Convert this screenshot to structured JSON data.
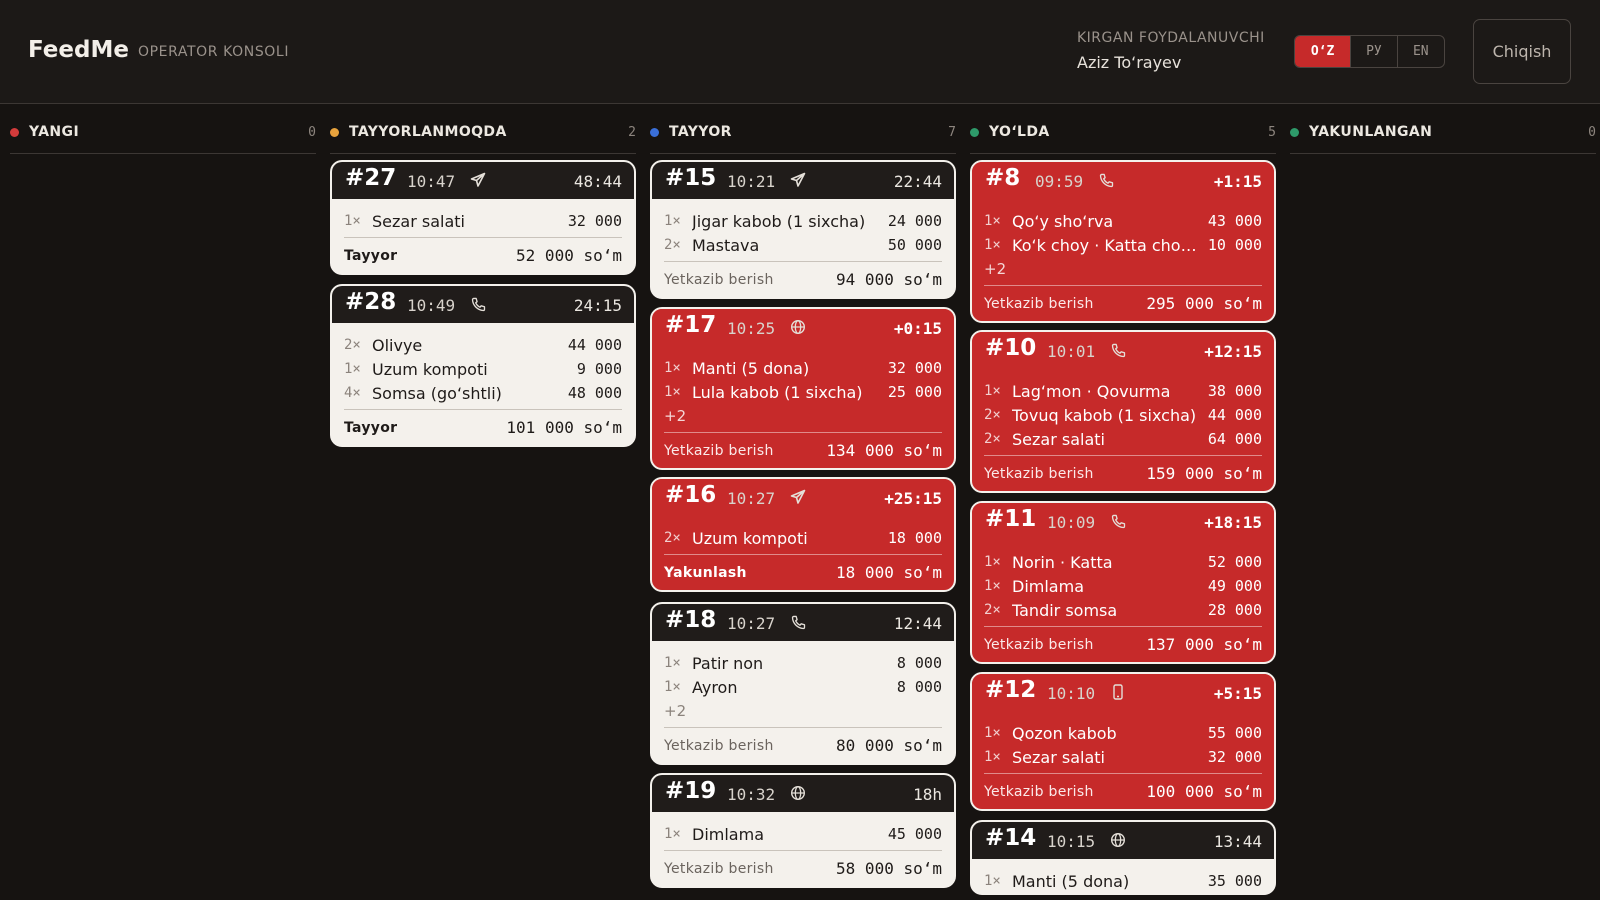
{
  "header": {
    "brand": "FeedMe",
    "subtitle": "OPERATOR KONSOLI",
    "user_label": "KIRGAN FOYDALANUVCHI",
    "user_name": "Aziz To‘rayev",
    "languages": [
      "O‘Z",
      "РУ",
      "EN"
    ],
    "active_language": "O‘Z",
    "logout_label": "Chiqish"
  },
  "colors": {
    "accent_red": "#c62a2a",
    "card_white": "#f4f1ec",
    "background": "#161311"
  },
  "columns": [
    {
      "title": "YANGI",
      "count": "0",
      "dot_color": "#d23b3b",
      "cards": []
    },
    {
      "title": "TAYYORLANMOQDA",
      "count": "2",
      "dot_color": "#e8a33d",
      "cards": [
        {
          "number": "#27",
          "time": "10:47",
          "channel_icon": "telegram-icon",
          "timer": "48:44",
          "overdue": false,
          "items": [
            {
              "qty": "1×",
              "name": "Sezar salati",
              "price": "32 000"
            }
          ],
          "more": "",
          "status": "Tayyor",
          "status_bold": true,
          "total": "52 000 so‘m"
        },
        {
          "number": "#28",
          "time": "10:49",
          "channel_icon": "phone-icon",
          "timer": "24:15",
          "overdue": false,
          "items": [
            {
              "qty": "2×",
              "name": "Olivye",
              "price": "44 000"
            },
            {
              "qty": "1×",
              "name": "Uzum kompoti",
              "price": "9 000"
            },
            {
              "qty": "4×",
              "name": "Somsa (go‘shtli)",
              "price": "48 000"
            }
          ],
          "more": "",
          "status": "Tayyor",
          "status_bold": true,
          "total": "101 000 so‘m"
        }
      ]
    },
    {
      "title": "TAYYOR",
      "count": "7",
      "dot_color": "#3a6fd8",
      "cards": [
        {
          "number": "#15",
          "time": "10:21",
          "channel_icon": "telegram-icon",
          "timer": "22:44",
          "overdue": false,
          "items": [
            {
              "qty": "1×",
              "name": "Jigar kabob (1 sixcha)",
              "price": "24 000"
            },
            {
              "qty": "2×",
              "name": "Mastava",
              "price": "50 000"
            }
          ],
          "more": "",
          "status": "Yetkazib berish",
          "status_bold": false,
          "total": "94 000 so‘m"
        },
        {
          "number": "#17",
          "time": "10:25",
          "channel_icon": "globe-icon",
          "timer": "+0:15",
          "overdue": true,
          "items": [
            {
              "qty": "1×",
              "name": "Manti (5 dona)",
              "price": "32 000"
            },
            {
              "qty": "1×",
              "name": "Lula kabob (1 sixcha)",
              "price": "25 000"
            }
          ],
          "more": "+2",
          "status": "Yetkazib berish",
          "status_bold": false,
          "total": "134 000 so‘m"
        },
        {
          "number": "#16",
          "time": "10:27",
          "channel_icon": "telegram-icon",
          "timer": "+25:15",
          "overdue": true,
          "items": [
            {
              "qty": "2×",
              "name": "Uzum kompoti",
              "price": "18 000"
            }
          ],
          "more": "",
          "status": "Yakunlash",
          "status_bold": true,
          "total": "18 000 so‘m"
        },
        {
          "number": "#18",
          "time": "10:27",
          "channel_icon": "phone-icon",
          "timer": "12:44",
          "overdue": false,
          "items": [
            {
              "qty": "1×",
              "name": "Patir non",
              "price": "8 000"
            },
            {
              "qty": "1×",
              "name": "Ayron",
              "price": "8 000"
            }
          ],
          "more": "+2",
          "status": "Yetkazib berish",
          "status_bold": false,
          "total": "80 000 so‘m"
        },
        {
          "number": "#19",
          "time": "10:32",
          "channel_icon": "globe-icon",
          "timer": "18h",
          "overdue": false,
          "items": [
            {
              "qty": "1×",
              "name": "Dimlama",
              "price": "45 000"
            }
          ],
          "more": "",
          "status": "Yetkazib berish",
          "status_bold": false,
          "total": "58 000 so‘m"
        }
      ]
    },
    {
      "title": "YO‘LDA",
      "count": "5",
      "dot_color": "#2e9a6a",
      "cards": [
        {
          "number": "#8",
          "time": "09:59",
          "channel_icon": "phone-icon",
          "timer": "+1:15",
          "overdue": true,
          "items": [
            {
              "qty": "1×",
              "name": "Qo‘y sho‘rva",
              "price": "43 000"
            },
            {
              "qty": "1×",
              "name": "Ko‘k choy · Katta choynak",
              "price": "10 000"
            }
          ],
          "more": "+2",
          "status": "Yetkazib berish",
          "status_bold": false,
          "total": "295 000 so‘m"
        },
        {
          "number": "#10",
          "time": "10:01",
          "channel_icon": "phone-icon",
          "timer": "+12:15",
          "overdue": true,
          "items": [
            {
              "qty": "1×",
              "name": "Lag‘mon · Qovurma",
              "price": "38 000"
            },
            {
              "qty": "2×",
              "name": "Tovuq kabob (1 sixcha)",
              "price": "44 000"
            },
            {
              "qty": "2×",
              "name": "Sezar salati",
              "price": "64 000"
            }
          ],
          "more": "",
          "status": "Yetkazib berish",
          "status_bold": false,
          "total": "159 000 so‘m"
        },
        {
          "number": "#11",
          "time": "10:09",
          "channel_icon": "phone-icon",
          "timer": "+18:15",
          "overdue": true,
          "items": [
            {
              "qty": "1×",
              "name": "Norin · Katta",
              "price": "52 000"
            },
            {
              "qty": "1×",
              "name": "Dimlama",
              "price": "49 000"
            },
            {
              "qty": "2×",
              "name": "Tandir somsa",
              "price": "28 000"
            }
          ],
          "more": "",
          "status": "Yetkazib berish",
          "status_bold": false,
          "total": "137 000 so‘m"
        },
        {
          "number": "#12",
          "time": "10:10",
          "channel_icon": "mobile-icon",
          "timer": "+5:15",
          "overdue": true,
          "items": [
            {
              "qty": "1×",
              "name": "Qozon kabob",
              "price": "55 000"
            },
            {
              "qty": "1×",
              "name": "Sezar salati",
              "price": "32 000"
            }
          ],
          "more": "",
          "status": "Yetkazib berish",
          "status_bold": false,
          "total": "100 000 so‘m"
        },
        {
          "number": "#14",
          "time": "10:15",
          "channel_icon": "globe-icon",
          "timer": "13:44",
          "overdue": false,
          "items": [
            {
              "qty": "1×",
              "name": "Manti (5 dona)",
              "price": "35 000"
            }
          ],
          "more": "",
          "status": "",
          "status_bold": false,
          "total": ""
        }
      ]
    },
    {
      "title": "YAKUNLANGAN",
      "count": "0",
      "dot_color": "#2e9a6a",
      "cards": []
    }
  ]
}
